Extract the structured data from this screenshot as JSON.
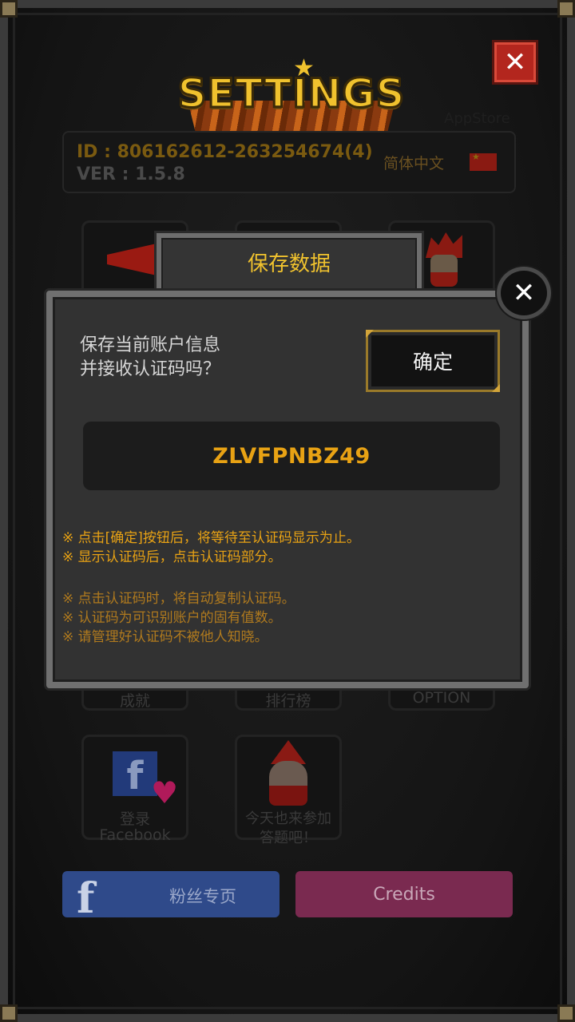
{
  "settings": {
    "logo_text": "SETTINGS",
    "store_label": "AppStore",
    "account": {
      "id_line": "ID : 806162612-263254674(4)",
      "ver_line": "VER : 1.5.8",
      "language": "简体中文"
    },
    "tiles": {
      "achievements": "成就",
      "ranking": "排行榜",
      "option": "OPTION",
      "facebook_login_line1": "登录",
      "facebook_login_line2": "Facebook",
      "quiz_line1": "今天也来参加",
      "quiz_line2": "答题吧！"
    },
    "fan_page_label": "粉丝专页",
    "credits_label": "Credits"
  },
  "dialog": {
    "title": "保存数据",
    "message_line1": "保存当前账户信息",
    "message_line2": "并接收认证码吗？",
    "confirm_label": "确定",
    "code": "ZLVFPNBZ49",
    "notes": [
      "※ 点击[确定]按钮后，将等待至认证码显示为止。",
      "※ 显示认证码后，点击认证码部分。",
      "※ 点击认证码时，将自动复制认证码。",
      "※ 认证码为可识别账户的固有值数。",
      "※ 请管理好认证码不被他人知晓。"
    ]
  },
  "colors": {
    "accent_gold": "#e8a214",
    "close_red": "#b3261e",
    "facebook_blue": "#2f4a8a",
    "credits_pink": "#7a2a50"
  }
}
